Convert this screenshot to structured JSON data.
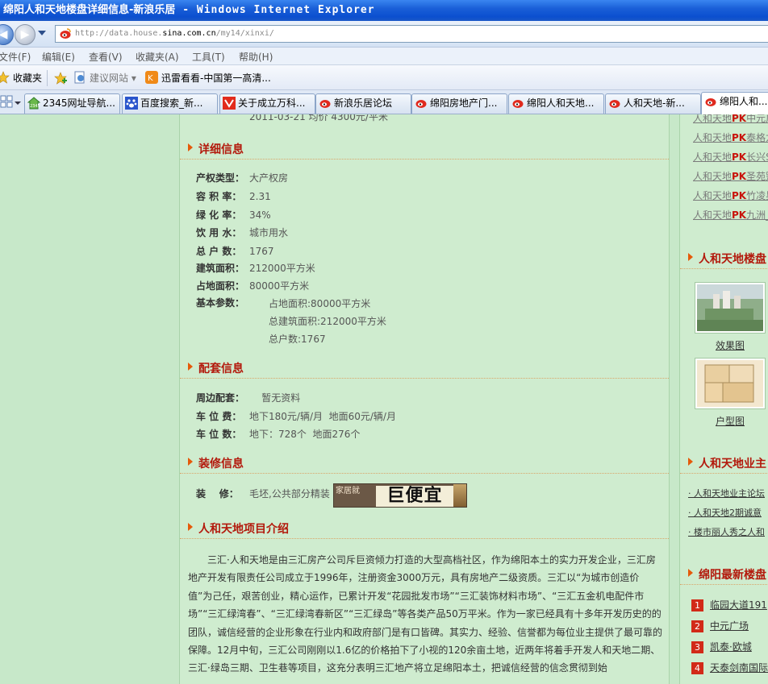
{
  "window": {
    "title": "绵阳人和天地楼盘详细信息-新浪乐居",
    "title_suffix": " - Windows Internet Explorer"
  },
  "address": {
    "url_prefix": "http://data.house.",
    "url_domain": "sina.com.cn",
    "url_suffix": "/my14/xinxi/"
  },
  "menu": {
    "items": [
      "文件(F)",
      "编辑(E)",
      "查看(V)",
      "收藏夹(A)",
      "工具(T)",
      "帮助(H)"
    ]
  },
  "favorites_bar": {
    "favorites_label": "收藏夹",
    "suggested_sites": "建议网站 ▾",
    "xunlei": "迅雷看看-中国第一高清..."
  },
  "tabs": [
    {
      "label": "2345网址导航..."
    },
    {
      "label": "百度搜索_新..."
    },
    {
      "label": "关于成立万科..."
    },
    {
      "label": "新浪乐居论坛"
    },
    {
      "label": "绵阳房地产门..."
    },
    {
      "label": "绵阳人和天地..."
    },
    {
      "label": "人和天地-新..."
    },
    {
      "label": "绵阳人和..."
    }
  ],
  "page": {
    "cut_top_text": "2011-03-21 均价 4300元/平米",
    "sections": {
      "detail": "详细信息",
      "facilities": "配套信息",
      "decoration": "装修信息",
      "intro": "人和天地项目介绍"
    },
    "detail_rows": [
      {
        "label": "产权类型：",
        "value": "大产权房"
      },
      {
        "label": "容 积 率：",
        "value": "2.31"
      },
      {
        "label": "绿 化 率：",
        "value": "34%"
      },
      {
        "label": "饮 用 水：",
        "value": "城市用水"
      },
      {
        "label": "总 户 数：",
        "value": "1767"
      },
      {
        "label": "建筑面积：",
        "value": "212000平方米"
      },
      {
        "label": "占地面积：",
        "value": "80000平方米"
      },
      {
        "label": "基本参数：",
        "value": ""
      }
    ],
    "basic_params": [
      "占地面积:80000平方米",
      "总建筑面积:212000平方米",
      "总户数:1767"
    ],
    "facility_rows": [
      {
        "label": "周边配套：",
        "value": "    暂无资料"
      },
      {
        "label": "车 位 费：",
        "value": "地下180元/辆/月  地面60元/辆/月"
      },
      {
        "label": "车 位 数：",
        "value": "地下：728个  地面276个"
      }
    ],
    "decoration_row": {
      "label": "装    修：",
      "value": "毛坯,公共部分精装"
    },
    "ad": {
      "small_text": "家居就",
      "big_text": "巨便宜"
    },
    "intro_text": "三汇·人和天地是由三汇房产公司斥巨资倾力打造的大型高档社区，作为绵阳本土的实力开发企业，三汇房地产开发有限责任公司成立于1996年，注册资金3000万元，具有房地产二级资质。三汇以“为城市创造价值”为己任，艰苦创业，精心运作，已累计开发“花园批发市场”“三汇装饰材料市场”、“三汇五金机电配件市场”“三汇绿湾春”、“三汇绿湾春新区”“三汇绿岛”等各类产品50万平米。作为一家已经具有十多年开发历史的的团队，诚信经营的企业形象在行业内和政府部门是有口皆碑。其实力、经验、信誉都为每位业主提供了最可靠的保障。12月中旬，三汇公司刚刚以1.6亿的价格拍下了小视的120余亩土地，近两年将着手开发人和天地二期、三汇·绿岛三期、卫生巷等项目，这充分表明三汇地产将立足绵阳本土，把诚信经营的信念贯彻到始"
  },
  "sidebar": {
    "pk_links": [
      {
        "a": "人和天地",
        "pk": "PK",
        "b": "中元广"
      },
      {
        "a": "人和天地",
        "pk": "PK",
        "b": "泰格龙"
      },
      {
        "a": "人和天地",
        "pk": "PK",
        "b": "长兴S"
      },
      {
        "a": "人和天地",
        "pk": "PK",
        "b": "圣苑别"
      },
      {
        "a": "人和天地",
        "pk": "PK",
        "b": "竹凌星"
      },
      {
        "a": "人和天地",
        "pk": "PK",
        "b": "九洲_"
      }
    ],
    "gallery_title": "人和天地楼盘",
    "gallery": [
      {
        "caption": "效果图"
      },
      {
        "caption": "户型图"
      }
    ],
    "forum_title": "人和天地业主",
    "forum_links": [
      "人和天地业主论坛",
      "人和天地2期诚意",
      "楼市丽人秀之人和"
    ],
    "newest_title": "绵阳最新楼盘",
    "newest": [
      {
        "num": "1",
        "name": "临园大道191"
      },
      {
        "num": "2",
        "name": "中元广场"
      },
      {
        "num": "3",
        "name": "凯泰·欧城"
      },
      {
        "num": "4",
        "name": "天泰剑南国际"
      }
    ]
  }
}
